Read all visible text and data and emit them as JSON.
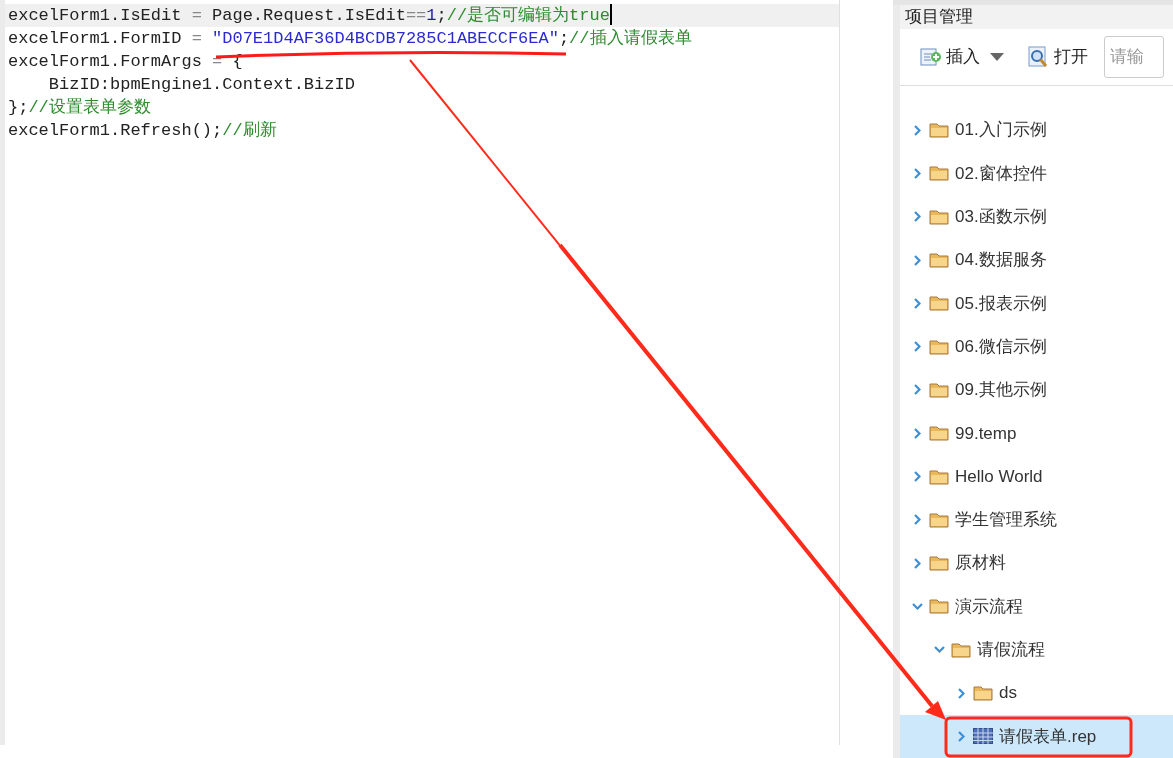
{
  "editor": {
    "lines": [
      {
        "current": true,
        "segments": [
          {
            "kind": "plain",
            "text": "excelForm1.IsEdit "
          },
          {
            "kind": "op",
            "text": "="
          },
          {
            "kind": "plain",
            "text": " Page.Request.IsEdit"
          },
          {
            "kind": "op",
            "text": "=="
          },
          {
            "kind": "number",
            "text": "1"
          },
          {
            "kind": "plain",
            "text": ";"
          },
          {
            "kind": "comment",
            "text": "//是否可编辑为true"
          }
        ]
      },
      {
        "current": false,
        "segments": [
          {
            "kind": "plain",
            "text": "excelForm1.FormID "
          },
          {
            "kind": "op",
            "text": "= "
          },
          {
            "kind": "string",
            "text": "\"D07E1D4AF36D4BCDB7285C1ABECCF6EA\""
          },
          {
            "kind": "plain",
            "text": ";"
          },
          {
            "kind": "comment",
            "text": "//插入请假表单"
          }
        ]
      },
      {
        "current": false,
        "segments": [
          {
            "kind": "plain",
            "text": "excelForm1.FormArgs "
          },
          {
            "kind": "op",
            "text": "="
          },
          {
            "kind": "plain",
            "text": " {"
          }
        ]
      },
      {
        "current": false,
        "segments": [
          {
            "kind": "plain",
            "text": "    BizID:bpmEngine1.Context.BizID"
          }
        ]
      },
      {
        "current": false,
        "segments": [
          {
            "kind": "plain",
            "text": "};"
          },
          {
            "kind": "comment",
            "text": "//设置表单参数"
          }
        ]
      },
      {
        "current": false,
        "segments": [
          {
            "kind": "plain",
            "text": "excelForm1.Refresh();"
          },
          {
            "kind": "comment",
            "text": "//刷新"
          }
        ]
      }
    ]
  },
  "project_panel": {
    "title": "项目管理",
    "toolbar": {
      "insert": "插入",
      "open": "打开",
      "search": {
        "placeholder": "请输"
      }
    },
    "tree": [
      {
        "label": "01.入门示例",
        "kind": "folder",
        "expanded": false,
        "selected": false
      },
      {
        "label": "02.窗体控件",
        "kind": "folder",
        "expanded": false,
        "selected": false
      },
      {
        "label": "03.函数示例",
        "kind": "folder",
        "expanded": false,
        "selected": false
      },
      {
        "label": "04.数据服务",
        "kind": "folder",
        "expanded": false,
        "selected": false
      },
      {
        "label": "05.报表示例",
        "kind": "folder",
        "expanded": false,
        "selected": false
      },
      {
        "label": "06.微信示例",
        "kind": "folder",
        "expanded": false,
        "selected": false
      },
      {
        "label": "09.其他示例",
        "kind": "folder",
        "expanded": false,
        "selected": false
      },
      {
        "label": "99.temp",
        "kind": "folder",
        "expanded": false,
        "selected": false
      },
      {
        "label": "Hello World",
        "kind": "folder",
        "expanded": false,
        "selected": false
      },
      {
        "label": "学生管理系统",
        "kind": "folder",
        "expanded": false,
        "selected": false
      },
      {
        "label": "原材料",
        "kind": "folder",
        "expanded": false,
        "selected": false
      },
      {
        "label": "演示流程",
        "kind": "folder",
        "expanded": true,
        "selected": false,
        "children": [
          {
            "label": "请假流程",
            "kind": "folder",
            "expanded": true,
            "selected": false,
            "children": [
              {
                "label": "ds",
                "kind": "folder",
                "expanded": false,
                "selected": false
              },
              {
                "label": "请假表单.rep",
                "kind": "report",
                "expanded": false,
                "selected": true
              }
            ]
          }
        ]
      }
    ]
  }
}
